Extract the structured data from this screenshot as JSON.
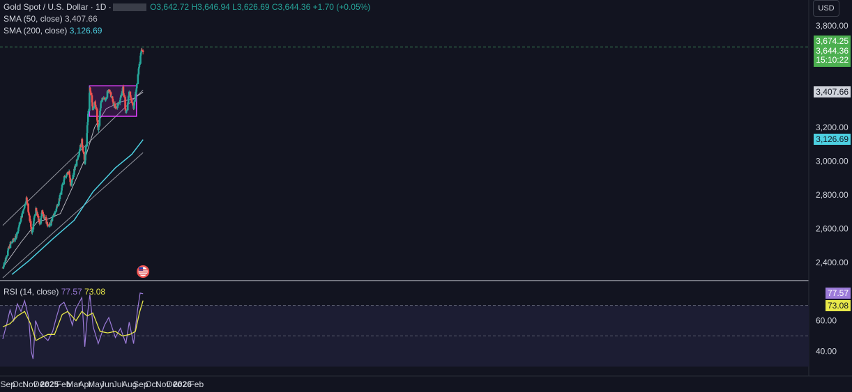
{
  "header": {
    "symbol": "Gold Spot / U.S. Dollar · 1D ·",
    "ohlc": "O3,642.72  H3,646.94  L3,626.69  C3,644.36  +1.70 (+0.05%)",
    "sma50_label": "SMA (50, close)",
    "sma50_value": "3,407.66",
    "sma200_label": "SMA (200, close)",
    "sma200_value": "3,126.69",
    "currency": "USD"
  },
  "price_tags": {
    "high_line": "3,674.25",
    "last": "3,644.36",
    "countdown": "15:10:22",
    "sma50": "3,407.66",
    "sma200": "3,126.69"
  },
  "rsi_header": {
    "label": "RSI (14, close)",
    "rsi_value": "77.57",
    "ma_value": "73.08"
  },
  "colors": {
    "background": "#121420",
    "up": "#26a69a",
    "down": "#ef5350",
    "sma50": "#b7b7bf",
    "sma200": "#4dd0e1",
    "rsi": "#9c7bd9",
    "rsi_ma": "#e8e84a",
    "range_box": "#e040fb",
    "last_price": "#4caf50"
  },
  "chart_data": [
    {
      "type": "candlestick",
      "title": "Gold Spot / U.S. Dollar",
      "x_tick_labels": [
        "Sep",
        "Oct",
        "Nov",
        "Dec",
        "2025",
        "Feb",
        "Mar",
        "Apr",
        "May",
        "Jun",
        "Jul",
        "Aug",
        "Sep",
        "Oct",
        "Nov",
        "Dec",
        "2026",
        "Feb"
      ],
      "y_tick_labels": [
        "3,800.00",
        "3,200.00",
        "3,000.00",
        "2,800.00",
        "2,600.00",
        "2,400.00"
      ],
      "ylim": [
        2330,
        3860
      ],
      "price_path": [
        [
          "2024-08-26",
          2370
        ],
        [
          "2024-09-15",
          2510
        ],
        [
          "2024-10-01",
          2550
        ],
        [
          "2024-10-15",
          2660
        ],
        [
          "2024-10-30",
          2780
        ],
        [
          "2024-11-14",
          2570
        ],
        [
          "2024-11-24",
          2720
        ],
        [
          "2024-12-05",
          2630
        ],
        [
          "2024-12-12",
          2700
        ],
        [
          "2024-12-30",
          2610
        ],
        [
          "2025-01-15",
          2690
        ],
        [
          "2025-01-30",
          2790
        ],
        [
          "2025-02-11",
          2910
        ],
        [
          "2025-02-24",
          2940
        ],
        [
          "2025-02-28",
          2850
        ],
        [
          "2025-03-15",
          2990
        ],
        [
          "2025-03-31",
          3120
        ],
        [
          "2025-04-08",
          2980
        ],
        [
          "2025-04-22",
          3430
        ],
        [
          "2025-04-30",
          3310
        ],
        [
          "2025-05-06",
          3360
        ],
        [
          "2025-05-15",
          3180
        ],
        [
          "2025-05-23",
          3360
        ],
        [
          "2025-06-04",
          3370
        ],
        [
          "2025-06-13",
          3430
        ],
        [
          "2025-06-30",
          3310
        ],
        [
          "2025-07-10",
          3340
        ],
        [
          "2025-07-22",
          3430
        ],
        [
          "2025-07-30",
          3280
        ],
        [
          "2025-08-08",
          3400
        ],
        [
          "2025-08-20",
          3320
        ],
        [
          "2025-08-29",
          3450
        ],
        [
          "2025-09-03",
          3540
        ],
        [
          "2025-09-09",
          3650
        ],
        [
          "2025-09-15",
          3644
        ]
      ],
      "sma50_path": [
        [
          "2024-08-26",
          2370
        ],
        [
          "2024-10-15",
          2520
        ],
        [
          "2024-11-28",
          2640
        ],
        [
          "2024-12-31",
          2660
        ],
        [
          "2025-01-31",
          2690
        ],
        [
          "2025-03-04",
          2840
        ],
        [
          "2025-04-08",
          3010
        ],
        [
          "2025-05-05",
          3200
        ],
        [
          "2025-06-06",
          3310
        ],
        [
          "2025-07-15",
          3350
        ],
        [
          "2025-08-20",
          3370
        ],
        [
          "2025-09-15",
          3407.66
        ]
      ],
      "sma200_path": [
        [
          "2024-09-20",
          2330
        ],
        [
          "2024-11-05",
          2410
        ],
        [
          "2025-01-10",
          2540
        ],
        [
          "2025-03-10",
          2650
        ],
        [
          "2025-05-01",
          2820
        ],
        [
          "2025-07-01",
          2960
        ],
        [
          "2025-08-15",
          3040
        ],
        [
          "2025-09-15",
          3126.69
        ]
      ],
      "trendlines": [
        {
          "from": [
            "2024-08-26",
            2620
          ],
          "to": [
            "2025-09-15",
            3420
          ]
        },
        {
          "from": [
            "2024-08-26",
            2310
          ],
          "to": [
            "2025-09-15",
            3050
          ]
        }
      ],
      "range_box": {
        "from": "2025-04-21",
        "to": "2025-08-28",
        "low": 3265,
        "high": 3445
      },
      "last_price": 3644.36,
      "high_line": 3674.25,
      "event_marker": {
        "date": "2025-09-15",
        "type": "us-flag-icon"
      }
    },
    {
      "type": "line",
      "title": "RSI (14, close)",
      "y_tick_labels": [
        "60.00",
        "40.00"
      ],
      "ylim": [
        33,
        82
      ],
      "level_lines": [
        70,
        50
      ],
      "rsi_path": [
        [
          "2024-08-26",
          48
        ],
        [
          "2024-09-06",
          58
        ],
        [
          "2024-09-15",
          67
        ],
        [
          "2024-09-25",
          60
        ],
        [
          "2024-10-05",
          71
        ],
        [
          "2024-10-15",
          66
        ],
        [
          "2024-10-25",
          73
        ],
        [
          "2024-11-05",
          62
        ],
        [
          "2024-11-12",
          40
        ],
        [
          "2024-11-17",
          35
        ],
        [
          "2024-11-24",
          60
        ],
        [
          "2024-12-05",
          53
        ],
        [
          "2024-12-15",
          50
        ],
        [
          "2024-12-28",
          47
        ],
        [
          "2025-01-10",
          53
        ],
        [
          "2025-01-20",
          62
        ],
        [
          "2025-01-30",
          70
        ],
        [
          "2025-02-10",
          72
        ],
        [
          "2025-02-24",
          64
        ],
        [
          "2025-03-05",
          57
        ],
        [
          "2025-03-15",
          68
        ],
        [
          "2025-03-31",
          75
        ],
        [
          "2025-04-08",
          43
        ],
        [
          "2025-04-16",
          65
        ],
        [
          "2025-04-22",
          77
        ],
        [
          "2025-05-01",
          56
        ],
        [
          "2025-05-15",
          45
        ],
        [
          "2025-06-01",
          57
        ],
        [
          "2025-06-13",
          62
        ],
        [
          "2025-07-01",
          49
        ],
        [
          "2025-07-15",
          55
        ],
        [
          "2025-07-30",
          45
        ],
        [
          "2025-08-08",
          59
        ],
        [
          "2025-08-20",
          45
        ],
        [
          "2025-08-31",
          67
        ],
        [
          "2025-09-07",
          78
        ],
        [
          "2025-09-15",
          77.57
        ]
      ],
      "rsi_ma_path": [
        [
          "2024-08-26",
          56
        ],
        [
          "2024-09-15",
          58
        ],
        [
          "2024-10-05",
          63
        ],
        [
          "2024-10-25",
          66
        ],
        [
          "2024-11-10",
          58
        ],
        [
          "2024-11-25",
          47
        ],
        [
          "2024-12-10",
          49
        ],
        [
          "2024-12-28",
          51
        ],
        [
          "2025-01-15",
          51
        ],
        [
          "2025-02-05",
          64
        ],
        [
          "2025-02-20",
          66
        ],
        [
          "2025-03-15",
          60
        ],
        [
          "2025-03-31",
          66
        ],
        [
          "2025-04-15",
          63
        ],
        [
          "2025-04-30",
          65
        ],
        [
          "2025-05-20",
          53
        ],
        [
          "2025-06-10",
          52
        ],
        [
          "2025-07-01",
          53
        ],
        [
          "2025-07-20",
          50
        ],
        [
          "2025-08-10",
          51
        ],
        [
          "2025-08-25",
          53
        ],
        [
          "2025-09-05",
          65
        ],
        [
          "2025-09-15",
          73.08
        ]
      ]
    }
  ]
}
